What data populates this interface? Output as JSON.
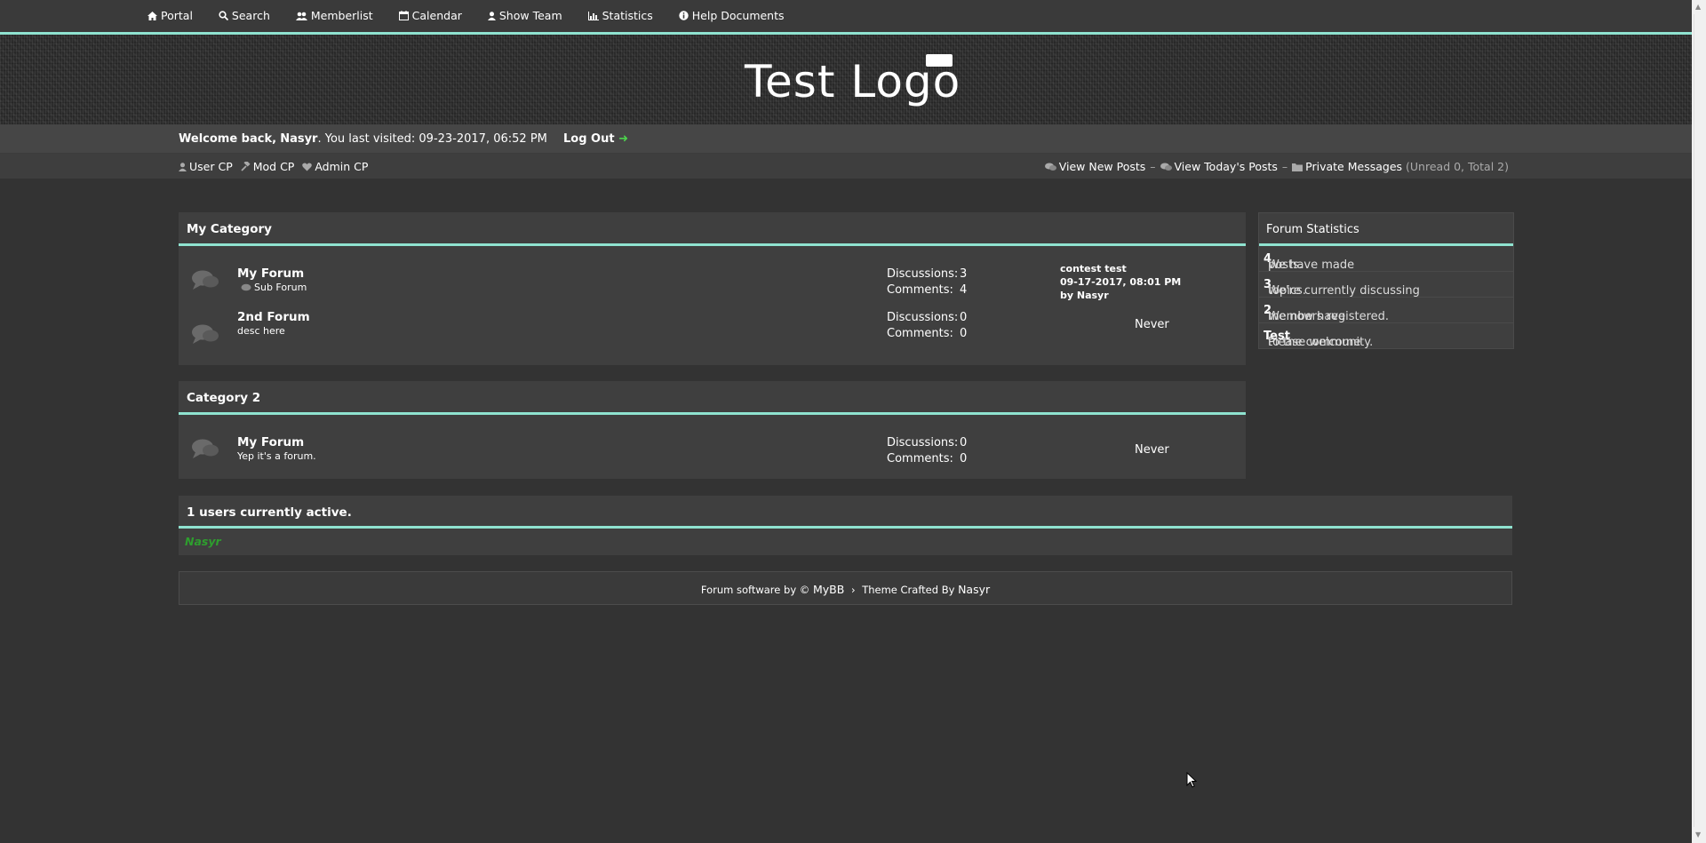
{
  "nav": {
    "items": [
      {
        "label": "Portal",
        "icon": "home-icon"
      },
      {
        "label": "Search",
        "icon": "search-icon"
      },
      {
        "label": "Memberlist",
        "icon": "users-icon"
      },
      {
        "label": "Calendar",
        "icon": "calendar-icon"
      },
      {
        "label": "Show Team",
        "icon": "user-icon"
      },
      {
        "label": "Statistics",
        "icon": "chart-icon"
      },
      {
        "label": "Help Documents",
        "icon": "info-icon"
      }
    ]
  },
  "header": {
    "logo_text": "Test Logo"
  },
  "welcome": {
    "prefix": "Welcome back,",
    "username": "Nasyr",
    "visited": ". You last visited: 09-23-2017, 06:52 PM",
    "logout": "Log Out"
  },
  "panel": {
    "left": [
      {
        "label": "User CP",
        "icon": "user-icon"
      },
      {
        "label": "Mod CP",
        "icon": "hammer-icon"
      },
      {
        "label": "Admin CP",
        "icon": "heart-icon"
      }
    ],
    "right": {
      "new_posts": "View New Posts",
      "todays_posts": "View Today's Posts",
      "pm": "Private Messages",
      "pm_counts": "(Unread 0, Total 2)",
      "separator": "–"
    }
  },
  "categories": [
    {
      "title": "My Category",
      "forums": [
        {
          "name": "My Forum",
          "desc": "Sub Forum",
          "discussions_label": "Discussions:",
          "discussions": "3",
          "comments_label": "Comments:",
          "comments": "4",
          "last_title": "contest test",
          "last_date": "09-17-2017, 08:01 PM",
          "last_by": "by Nasyr"
        },
        {
          "name": "2nd Forum",
          "desc": "desc here",
          "discussions_label": "Discussions:",
          "discussions": "0",
          "comments_label": "Comments:",
          "comments": "0",
          "never": "Never"
        }
      ]
    },
    {
      "title": "Category 2",
      "forums": [
        {
          "name": "My Forum",
          "desc": "Yep it's a forum.",
          "discussions_label": "Discussions:",
          "discussions": "0",
          "comments_label": "Comments:",
          "comments": "0",
          "never": "Never"
        }
      ]
    }
  ],
  "stats": {
    "title": "Forum Statistics",
    "posts_pre": "We have made",
    "posts": "4",
    "posts_post": "posts.",
    "topics_pre": "We're currently discussing",
    "topics": "3",
    "topics_post": "topics.",
    "members_pre": "We now have",
    "members": "2",
    "members_post": "members registered.",
    "welcome_pre": "Please welcome",
    "newest": "Test",
    "welcome_post": "to the community."
  },
  "online": {
    "title": "1 users currently active.",
    "user": "Nasyr"
  },
  "footer": {
    "software": "Forum software by ©",
    "brand": "MyBB",
    "theme": "Theme Crafted By",
    "author": "Nasyr"
  },
  "colors": {
    "accent": "#8fe3d0",
    "background": "#333333",
    "panel": "#3f3f3f",
    "online_user": "#2e9e2e"
  }
}
